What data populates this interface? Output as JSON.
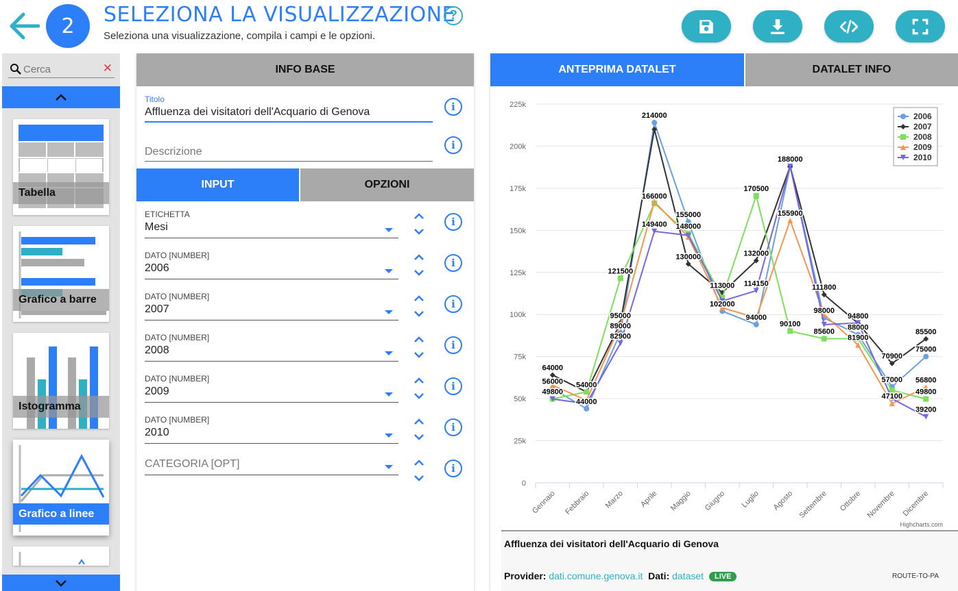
{
  "header": {
    "step": "2",
    "title": "SELEZIONA LA VISUALIZZAZIONE",
    "help": "?",
    "subtitle": "Seleziona una visualizzazione, compila i campi e le opzioni."
  },
  "sidebar": {
    "search_placeholder": "Cerca",
    "clear": "✕",
    "items": [
      {
        "label": "Tabella"
      },
      {
        "label": "Grafico a barre"
      },
      {
        "label": "Istogramma"
      },
      {
        "label": "Grafico a linee"
      }
    ]
  },
  "info_base": {
    "header": "INFO BASE",
    "title_label": "Titolo",
    "title_value": "Affluenza dei visitatori dell'Acquario di Genova",
    "description_placeholder": "Descrizione",
    "info_glyph": "i",
    "tabs": [
      "INPUT",
      "OPZIONI"
    ],
    "fields": [
      {
        "label": "ETICHETTA",
        "value": "Mesi"
      },
      {
        "label": "DATO [NUMBER]",
        "value": "2006"
      },
      {
        "label": "DATO [NUMBER]",
        "value": "2007"
      },
      {
        "label": "DATO [NUMBER]",
        "value": "2008"
      },
      {
        "label": "DATO [NUMBER]",
        "value": "2009"
      },
      {
        "label": "DATO [NUMBER]",
        "value": "2010"
      },
      {
        "label": "",
        "value": "CATEGORIA [OPT]"
      }
    ]
  },
  "preview": {
    "tabs": [
      "ANTEPRIMA DATALET",
      "DATALET INFO"
    ],
    "credits": "Highcharts.com",
    "footer_title": "Affluenza dei visitatori dell'Acquario di Genova",
    "provider_label": "Provider:",
    "provider_value": "dati.comune.genova.it",
    "data_label": "Dati:",
    "data_value": "dataset",
    "live": "LIVE",
    "route": "ROUTE-TO-PA"
  },
  "colors": {
    "accent": "#2d7ff9",
    "teal": "#2fb0c4",
    "s2006": "#6a9fe0",
    "s2007": "#333333",
    "s2008": "#7ee05a",
    "s2009": "#f7954e",
    "s2010": "#7367e6"
  },
  "chart_data": {
    "type": "line",
    "categories": [
      "Gennaio",
      "Febbraio",
      "Marzo",
      "Aprile",
      "Maggio",
      "Giugno",
      "Luglio",
      "Agosto",
      "Settembre",
      "Ottobre",
      "Novembre",
      "Dicembre"
    ],
    "ylim": [
      0,
      225000
    ],
    "yticks": [
      0,
      25000,
      50000,
      75000,
      100000,
      125000,
      150000,
      175000,
      200000,
      225000
    ],
    "ytick_labels": [
      "0",
      "25k",
      "50k",
      "75k",
      "100k",
      "125k",
      "150k",
      "175k",
      "200k",
      "225k"
    ],
    "grid": true,
    "legend": "top-right",
    "series": [
      {
        "name": "2006",
        "marker": "circle",
        "values": [
          56000,
          44000,
          89000,
          214000,
          155000,
          102000,
          94000,
          188000,
          98000,
          88000,
          57000,
          75000
        ]
      },
      {
        "name": "2007",
        "marker": "diamond",
        "values": [
          64000,
          54000,
          95000,
          210000,
          130000,
          113000,
          132000,
          188000,
          111800,
          94800,
          70900,
          85500
        ]
      },
      {
        "name": "2008",
        "marker": "square",
        "values": [
          49800,
          54000,
          121500,
          166000,
          148000,
          110000,
          170500,
          90100,
          85600,
          85600,
          55000,
          49800
        ]
      },
      {
        "name": "2009",
        "marker": "triangle",
        "values": [
          58000,
          49000,
          94000,
          167000,
          146000,
          104000,
          98000,
          155900,
          100000,
          81900,
          47100,
          56800
        ]
      },
      {
        "name": "2010",
        "marker": "triangle-down",
        "values": [
          49800,
          47000,
          82900,
          149400,
          147000,
          108000,
          114150,
          188000,
          94000,
          95000,
          50000,
          39200
        ]
      }
    ],
    "data_labels": [
      {
        "cat": 0,
        "value": 64000,
        "text": "64000"
      },
      {
        "cat": 0,
        "value": 56000,
        "text": "56000"
      },
      {
        "cat": 0,
        "value": 49800,
        "text": "49800"
      },
      {
        "cat": 1,
        "value": 54000,
        "text": "54000"
      },
      {
        "cat": 1,
        "value": 44000,
        "text": "44000"
      },
      {
        "cat": 2,
        "value": 121500,
        "text": "121500"
      },
      {
        "cat": 2,
        "value": 95000,
        "text": "95000"
      },
      {
        "cat": 2,
        "value": 89000,
        "text": "89000"
      },
      {
        "cat": 2,
        "value": 82900,
        "text": "82900"
      },
      {
        "cat": 3,
        "value": 214000,
        "text": "214000"
      },
      {
        "cat": 3,
        "value": 166000,
        "text": "166000"
      },
      {
        "cat": 3,
        "value": 149400,
        "text": "149400"
      },
      {
        "cat": 4,
        "value": 155000,
        "text": "155000"
      },
      {
        "cat": 4,
        "value": 148000,
        "text": "148000"
      },
      {
        "cat": 4,
        "value": 130000,
        "text": "130000"
      },
      {
        "cat": 5,
        "value": 113000,
        "text": "113000"
      },
      {
        "cat": 5,
        "value": 102000,
        "text": "102000"
      },
      {
        "cat": 6,
        "value": 170500,
        "text": "170500"
      },
      {
        "cat": 6,
        "value": 132000,
        "text": "132000"
      },
      {
        "cat": 6,
        "value": 114150,
        "text": "114150"
      },
      {
        "cat": 6,
        "value": 94000,
        "text": "94000"
      },
      {
        "cat": 7,
        "value": 188000,
        "text": "188000"
      },
      {
        "cat": 7,
        "value": 155900,
        "text": "155900"
      },
      {
        "cat": 7,
        "value": 90100,
        "text": "90100"
      },
      {
        "cat": 8,
        "value": 111800,
        "text": "111800"
      },
      {
        "cat": 8,
        "value": 98000,
        "text": "98000"
      },
      {
        "cat": 8,
        "value": 85600,
        "text": "85600"
      },
      {
        "cat": 9,
        "value": 94800,
        "text": "94800"
      },
      {
        "cat": 9,
        "value": 88000,
        "text": "88000"
      },
      {
        "cat": 9,
        "value": 81900,
        "text": "81900"
      },
      {
        "cat": 10,
        "value": 70900,
        "text": "70900"
      },
      {
        "cat": 10,
        "value": 57000,
        "text": "57000"
      },
      {
        "cat": 10,
        "value": 47100,
        "text": "47100"
      },
      {
        "cat": 11,
        "value": 85500,
        "text": "85500"
      },
      {
        "cat": 11,
        "value": 75000,
        "text": "75000"
      },
      {
        "cat": 11,
        "value": 56800,
        "text": "56800"
      },
      {
        "cat": 11,
        "value": 49800,
        "text": "49800"
      },
      {
        "cat": 11,
        "value": 39200,
        "text": "39200"
      }
    ]
  }
}
